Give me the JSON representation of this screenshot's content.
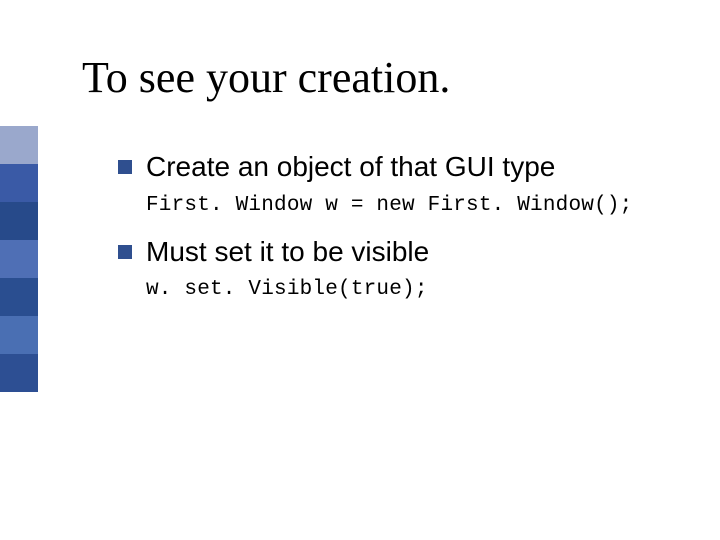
{
  "title": "To see your creation.",
  "bullets": [
    {
      "text": "Create an object of that GUI type",
      "code": "First. Window w = new First. Window();"
    },
    {
      "text": "Must set it to be visible",
      "code": "w. set. Visible(true);"
    }
  ],
  "sidebar_colors": [
    "#9aa8cc",
    "#3a5aa6",
    "#274a8a",
    "#4f6fb5",
    "#2a4e90",
    "#4a6fb3",
    "#2d4f93"
  ]
}
